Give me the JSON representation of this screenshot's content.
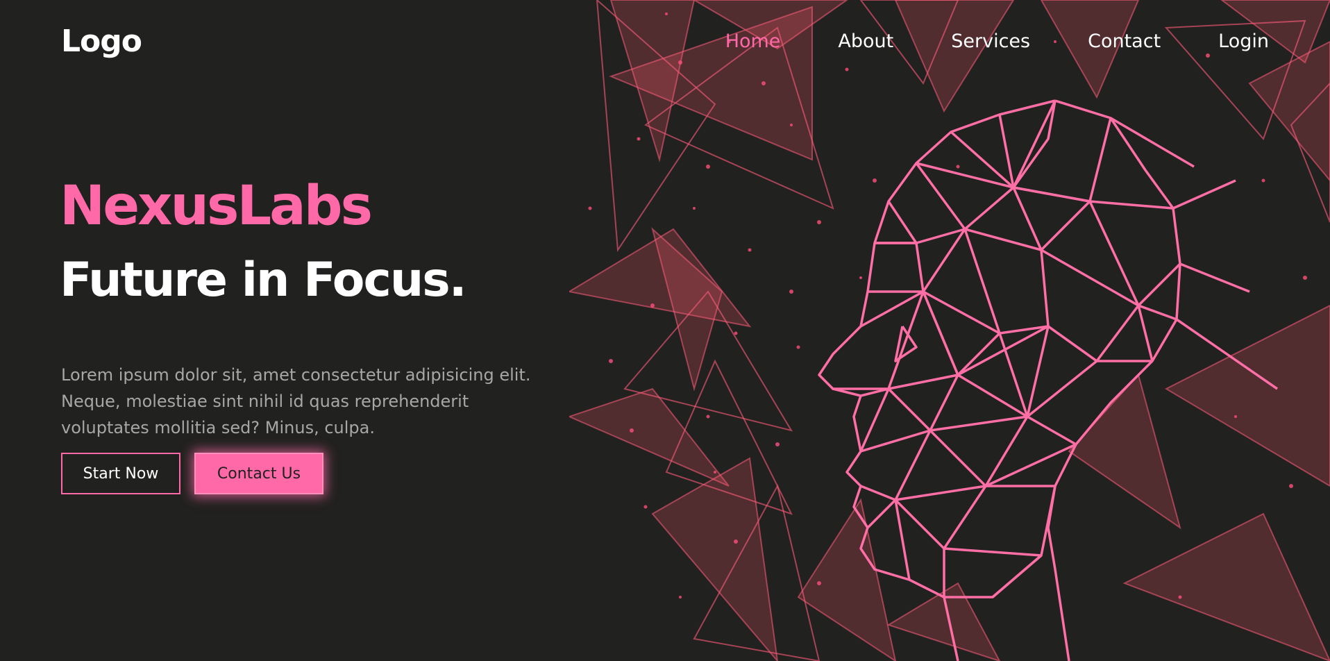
{
  "header": {
    "logo": "Logo",
    "nav": [
      {
        "label": "Home",
        "active": true
      },
      {
        "label": "About",
        "active": false
      },
      {
        "label": "Services",
        "active": false
      },
      {
        "label": "Contact",
        "active": false
      },
      {
        "label": "Login",
        "active": false
      }
    ]
  },
  "hero": {
    "brand": "NexusLabs",
    "tagline": "Future in Focus.",
    "description": "Lorem ipsum dolor sit, amet consectetur adipisicing elit. Neque, molestiae sint nihil id quas reprehenderit voluptates mollitia sed? Minus, culpa.",
    "primary_button": "Start Now",
    "secondary_button": "Contact Us"
  },
  "colors": {
    "background": "#21211f",
    "accent": "#ff69a8",
    "text": "#ffffff",
    "muted_text": "#a7a7a7"
  },
  "illustration": {
    "icon": "wireframe-head-icon"
  }
}
